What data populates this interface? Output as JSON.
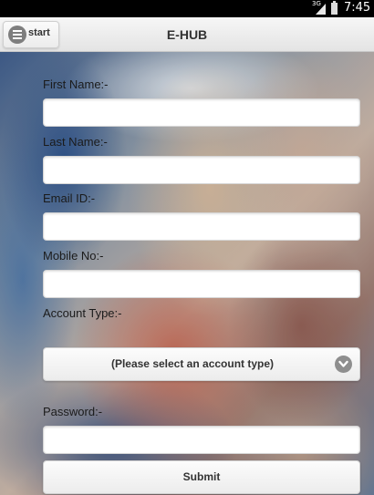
{
  "status_bar": {
    "network": "3G",
    "time": "7:45"
  },
  "header": {
    "start_label": "start",
    "title": "E-HUB"
  },
  "form": {
    "first_name_label": "First Name:-",
    "first_name_value": "",
    "last_name_label": "Last Name:-",
    "last_name_value": "",
    "email_label": "Email ID:-",
    "email_value": "",
    "mobile_label": "Mobile No:-",
    "mobile_value": "",
    "account_type_label": "Account Type:-",
    "account_type_selected": "(Please select an account type)",
    "password_label": "Password:-",
    "password_value": "",
    "submit_label": "Submit"
  },
  "icons": {
    "menu": "menu-icon",
    "dropdown": "chevron-down-icon",
    "signal": "signal-icon",
    "battery": "battery-icon"
  }
}
